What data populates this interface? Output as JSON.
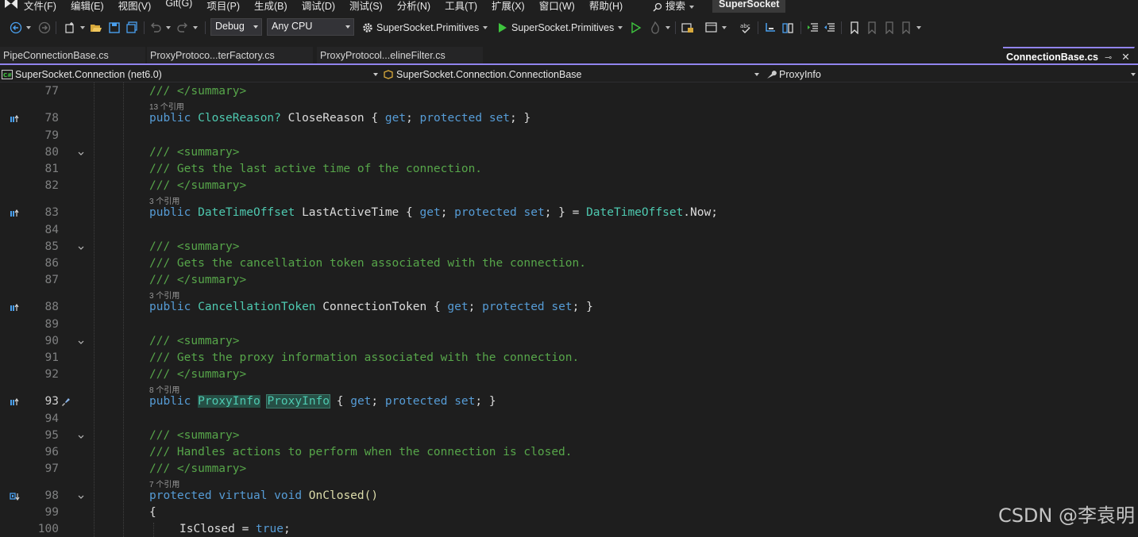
{
  "menu": {
    "items": [
      "文件(F)",
      "编辑(E)",
      "视图(V)",
      "Git(G)",
      "项目(P)",
      "生成(B)",
      "调试(D)",
      "测试(S)",
      "分析(N)",
      "工具(T)",
      "扩展(X)",
      "窗口(W)",
      "帮助(H)"
    ],
    "search_label": "搜索",
    "solution_name": "SuperSocket"
  },
  "toolbar": {
    "config": "Debug",
    "platform": "Any CPU",
    "startup_project": "SuperSocket.Primitives",
    "run_target": "SuperSocket.Primitives"
  },
  "tabs": [
    {
      "label": "PipeConnectionBase.cs",
      "active": false
    },
    {
      "label": "ProxyProtoco...terFactory.cs",
      "active": false
    },
    {
      "label": "ProxyProtocol...elineFilter.cs",
      "active": false
    },
    {
      "label": "ConnectionBase.cs",
      "active": true
    }
  ],
  "tab_close_glyph": "✕",
  "navbar": {
    "project": "SuperSocket.Connection (net6.0)",
    "type": "SuperSocket.Connection.ConnectionBase",
    "member": "ProxyInfo"
  },
  "code": {
    "l77": {
      "num": "77",
      "summary_end": "/// </summary>"
    },
    "lens1": "13 个引用",
    "l78": {
      "num": "78",
      "kw": "public",
      "type": "CloseReason?",
      "name": " CloseReason",
      "open": " { ",
      "get": "get",
      "semi1": "; ",
      "prot": "protected",
      "sp": " ",
      "set": "set",
      "close": "; }"
    },
    "l79": {
      "num": "79"
    },
    "l80": {
      "num": "80",
      "text": "/// <summary>"
    },
    "l81": {
      "num": "81",
      "text": "/// Gets the last active time of the connection."
    },
    "l82": {
      "num": "82",
      "text": "/// </summary>"
    },
    "lens2": "3 个引用",
    "l83": {
      "num": "83",
      "kw": "public",
      "type": "DateTimeOffset",
      "name": " LastActiveTime",
      "open": " { ",
      "get": "get",
      "semi1": "; ",
      "prot": "protected",
      "sp": " ",
      "set": "set",
      "close": "; } = ",
      "init_type": "DateTimeOffset",
      "init_rest": ".Now;"
    },
    "l84": {
      "num": "84"
    },
    "l85": {
      "num": "85",
      "text": "/// <summary>"
    },
    "l86": {
      "num": "86",
      "text": "/// Gets the cancellation token associated with the connection."
    },
    "l87": {
      "num": "87",
      "text": "/// </summary>"
    },
    "lens3": "3 个引用",
    "l88": {
      "num": "88",
      "kw": "public",
      "type": "CancellationToken",
      "name": " ConnectionToken",
      "open": " { ",
      "get": "get",
      "semi1": "; ",
      "prot": "protected",
      "sp": " ",
      "set": "set",
      "close": "; }"
    },
    "l89": {
      "num": "89"
    },
    "l90": {
      "num": "90",
      "text": "/// <summary>"
    },
    "l91": {
      "num": "91",
      "text": "/// Gets the proxy information associated with the connection."
    },
    "l92": {
      "num": "92",
      "text": "/// </summary>"
    },
    "lens4": "8 个引用",
    "l93": {
      "num": "93",
      "kw": "public",
      "type": "ProxyInfo",
      "name": "ProxyInfo",
      "open": " { ",
      "get": "get",
      "semi1": "; ",
      "prot": "protected",
      "sp": " ",
      "set": "set",
      "close": "; }"
    },
    "l94": {
      "num": "94"
    },
    "l95": {
      "num": "95",
      "text": "/// <summary>"
    },
    "l96": {
      "num": "96",
      "text": "/// Handles actions to perform when the connection is closed."
    },
    "l97": {
      "num": "97",
      "text": "/// </summary>"
    },
    "lens5": "7 个引用",
    "l98": {
      "num": "98",
      "kw1": "protected",
      "kw2": "virtual",
      "kw3": "void",
      "rest": " OnClosed()"
    },
    "l99": {
      "num": "99",
      "text": "{"
    },
    "l100": {
      "num": "100",
      "name": "IsClosed = ",
      "val": "true",
      "end": ";"
    }
  },
  "watermark": "CSDN @李袁明",
  "colors": {
    "accent": "#9184ee",
    "keyword": "#569cd6",
    "comment": "#57a64a",
    "type": "#4ec9b0"
  }
}
